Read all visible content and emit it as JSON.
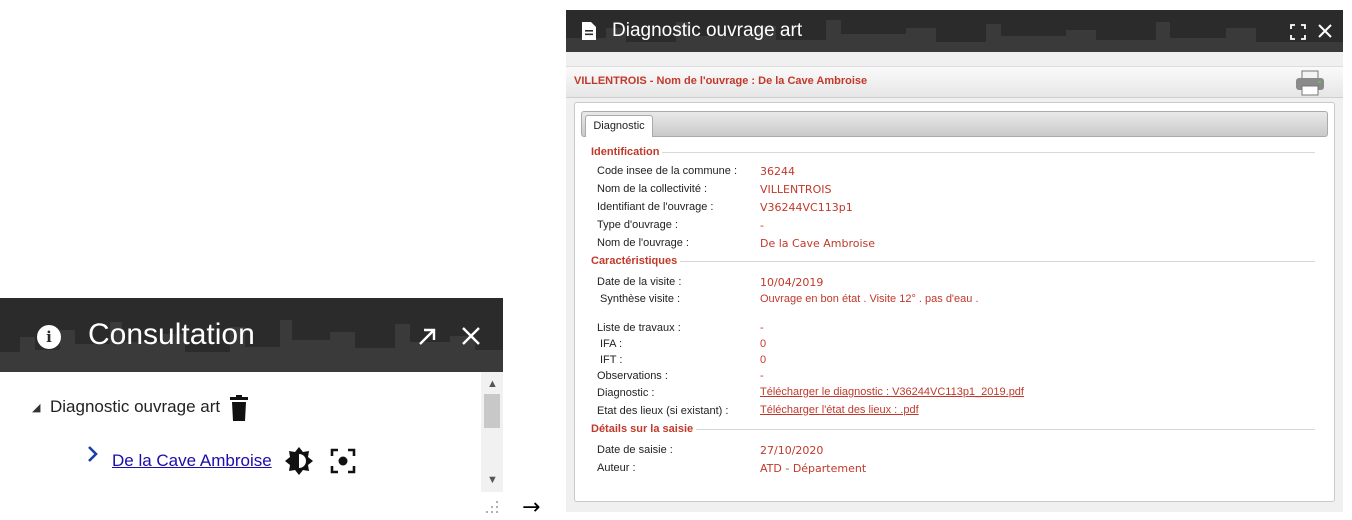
{
  "consultation": {
    "title": "Consultation",
    "tree_label": "Diagnostic ouvrage art",
    "item_link": "De la Cave Ambroise"
  },
  "arrow": "→",
  "diag": {
    "title": "Diagnostic ouvrage art",
    "subtitle": "VILLENTROIS - Nom de l'ouvrage : De la Cave Ambroise",
    "tab": "Diagnostic",
    "sections": {
      "identification": "Identification",
      "caracteristiques": "Caractéristiques",
      "details": "Détails sur la saisie"
    },
    "rows": {
      "code_insee": {
        "label": "Code insee de la commune :",
        "value": "36244"
      },
      "collectivite": {
        "label": "Nom de la collectivité :",
        "value": "VILLENTROIS"
      },
      "identifiant": {
        "label": "Identifiant de l'ouvrage :",
        "value": "V36244VC113p1"
      },
      "type": {
        "label": "Type d'ouvrage :",
        "value": "-"
      },
      "nom": {
        "label": "Nom de l'ouvrage :",
        "value": "De la Cave Ambroise"
      },
      "date_visite": {
        "label": "Date de la visite :",
        "value": "10/04/2019"
      },
      "synthese": {
        "label": "Synthèse visite :",
        "value": "Ouvrage en bon état . Visite 12° . pas d'eau ."
      },
      "travaux": {
        "label": "Liste de travaux :",
        "value": "-"
      },
      "ifa": {
        "label": "IFA :",
        "value": "0"
      },
      "ift": {
        "label": "IFT :",
        "value": "0"
      },
      "observations": {
        "label": "Observations :",
        "value": "-"
      },
      "diagnostic": {
        "label": "Diagnostic :",
        "value": "Télécharger le diagnostic : V36244VC113p1_2019.pdf"
      },
      "etat_lieux": {
        "label": "Etat des lieux (si existant) :",
        "value": "Télécharger l'état des lieux : .pdf"
      },
      "date_saisie": {
        "label": "Date de saisie :",
        "value": "27/10/2020"
      },
      "auteur": {
        "label": "Auteur :",
        "value": "ATD - Département"
      }
    }
  },
  "colors": {
    "header_bg": "#2b2b2b",
    "accent_red": "#c0392b",
    "link_blue": "#1a0dab"
  },
  "icons": {
    "consultation": [
      "info-icon",
      "expand-arrow-icon",
      "close-icon",
      "trash-icon",
      "chevron-right-icon",
      "brightness-icon",
      "focus-icon",
      "resize-grip-icon"
    ],
    "diag": [
      "document-icon",
      "fullscreen-icon",
      "close-icon",
      "printer-icon"
    ]
  }
}
